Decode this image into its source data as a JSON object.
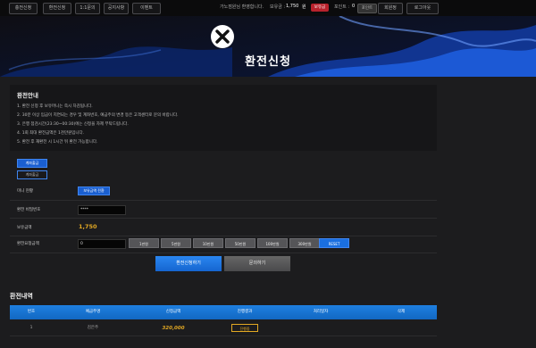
{
  "nav": {
    "items": [
      {
        "label": "충전신청"
      },
      {
        "label": "환전신청"
      },
      {
        "label": "1:1문의"
      },
      {
        "label": "공지사항"
      },
      {
        "label": "이벤트"
      }
    ]
  },
  "user": {
    "greeting": "가노점원님 환영합니다.",
    "balance_label": "보유금 :",
    "balance_value": "1,750",
    "balance_unit": "원",
    "balance_badge": "보유금",
    "point_label": "포인트 :",
    "point_value": "0",
    "point_badge": "포인트",
    "mypage_label": "회원정",
    "logout_label": "로그아웃"
  },
  "hero": {
    "title": "환전신청"
  },
  "guide": {
    "title": "환전안내",
    "lines": [
      "1. 환전 신청 후 보유머니는 즉시 차감됩니다.",
      "2. 30분 이상 입금이 지연되는 경우 및 계좌번호, 예금주의 변경 등은 고객센터로 문의 바랍니다.",
      "3. 은행 점검시간(23:30~00:30)에는 신청을 자제 부탁드립니다.",
      "4. 1회 최대 환전금액은 1천만원입니다.",
      "5. 환전 후 재환전 시 1시간 뒤 환전 가능합니다."
    ]
  },
  "account_buttons": {
    "bank": "계좌출금",
    "other": "계좌출금"
  },
  "form": {
    "mini_label": "미니 현황",
    "mini_button": "보유금액 전환",
    "pw_label": "환전 비밀번호",
    "pw_value": "****",
    "balance_label": "보유금액",
    "balance_value": "1,750",
    "amount_label": "환전요청금액",
    "amount_value": "0",
    "amount_buttons": [
      "1만원",
      "5만원",
      "10만원",
      "50만원",
      "100만원",
      "300만원",
      "RESET"
    ]
  },
  "actions": {
    "submit": "환전신청하기",
    "cancel": "문의하기"
  },
  "history": {
    "title": "환전내역",
    "columns": [
      "번호",
      "예금주명",
      "신청금액",
      "진행결과",
      "처리일자",
      "삭제"
    ],
    "rows": [
      {
        "no": "1",
        "name": "김은주",
        "amount": "320,000",
        "status": "진행중"
      }
    ]
  },
  "colors": {
    "accent": "#1a6fe0",
    "amount_highlight": "#e2a823",
    "badge_red": "#b8222c"
  }
}
